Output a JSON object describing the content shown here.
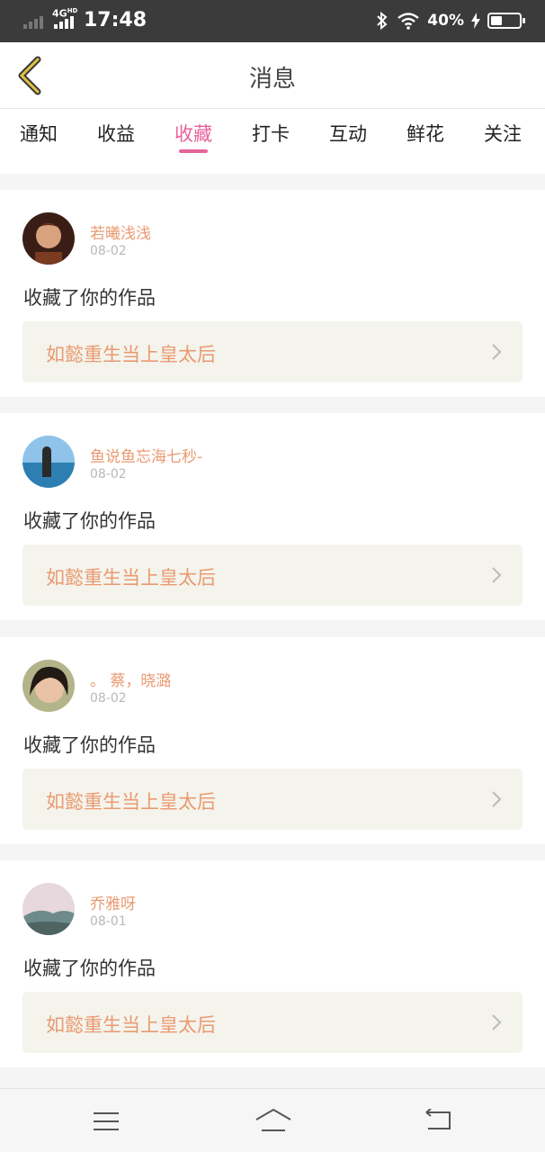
{
  "status_bar": {
    "network": "4G",
    "network_sup": "HD",
    "time": "17:48",
    "battery": "40%",
    "battery_level": 0.4
  },
  "header": {
    "title": "消息"
  },
  "tabs": [
    {
      "label": "通知",
      "active": false
    },
    {
      "label": "收益",
      "active": false
    },
    {
      "label": "收藏",
      "active": true
    },
    {
      "label": "打卡",
      "active": false
    },
    {
      "label": "互动",
      "active": false
    },
    {
      "label": "鲜花",
      "active": false
    },
    {
      "label": "关注",
      "active": false
    }
  ],
  "messages": [
    {
      "username": "若曦浅浅",
      "date": "08-02",
      "action": "收藏了你的作品",
      "work_title": "如懿重生当上皇太后"
    },
    {
      "username": "鱼说鱼忘海七秒-",
      "date": "08-02",
      "action": "收藏了你的作品",
      "work_title": "如懿重生当上皇太后"
    },
    {
      "username": "。 蔡，晓潞",
      "date": "08-02",
      "action": "收藏了你的作品",
      "work_title": "如懿重生当上皇太后"
    },
    {
      "username": "乔雅呀",
      "date": "08-01",
      "action": "收藏了你的作品",
      "work_title": "如懿重生当上皇太后"
    }
  ],
  "colors": {
    "accent": "#e8639c",
    "username": "#ea9a72",
    "status_bar": "#3b3b3b",
    "work_box": "#f4f4ec"
  },
  "icons": {
    "back": "chevron-left-icon",
    "row_arrow": "chevron-right-icon",
    "nav_menu": "menu-icon",
    "nav_home": "home-icon",
    "nav_back": "return-icon"
  }
}
